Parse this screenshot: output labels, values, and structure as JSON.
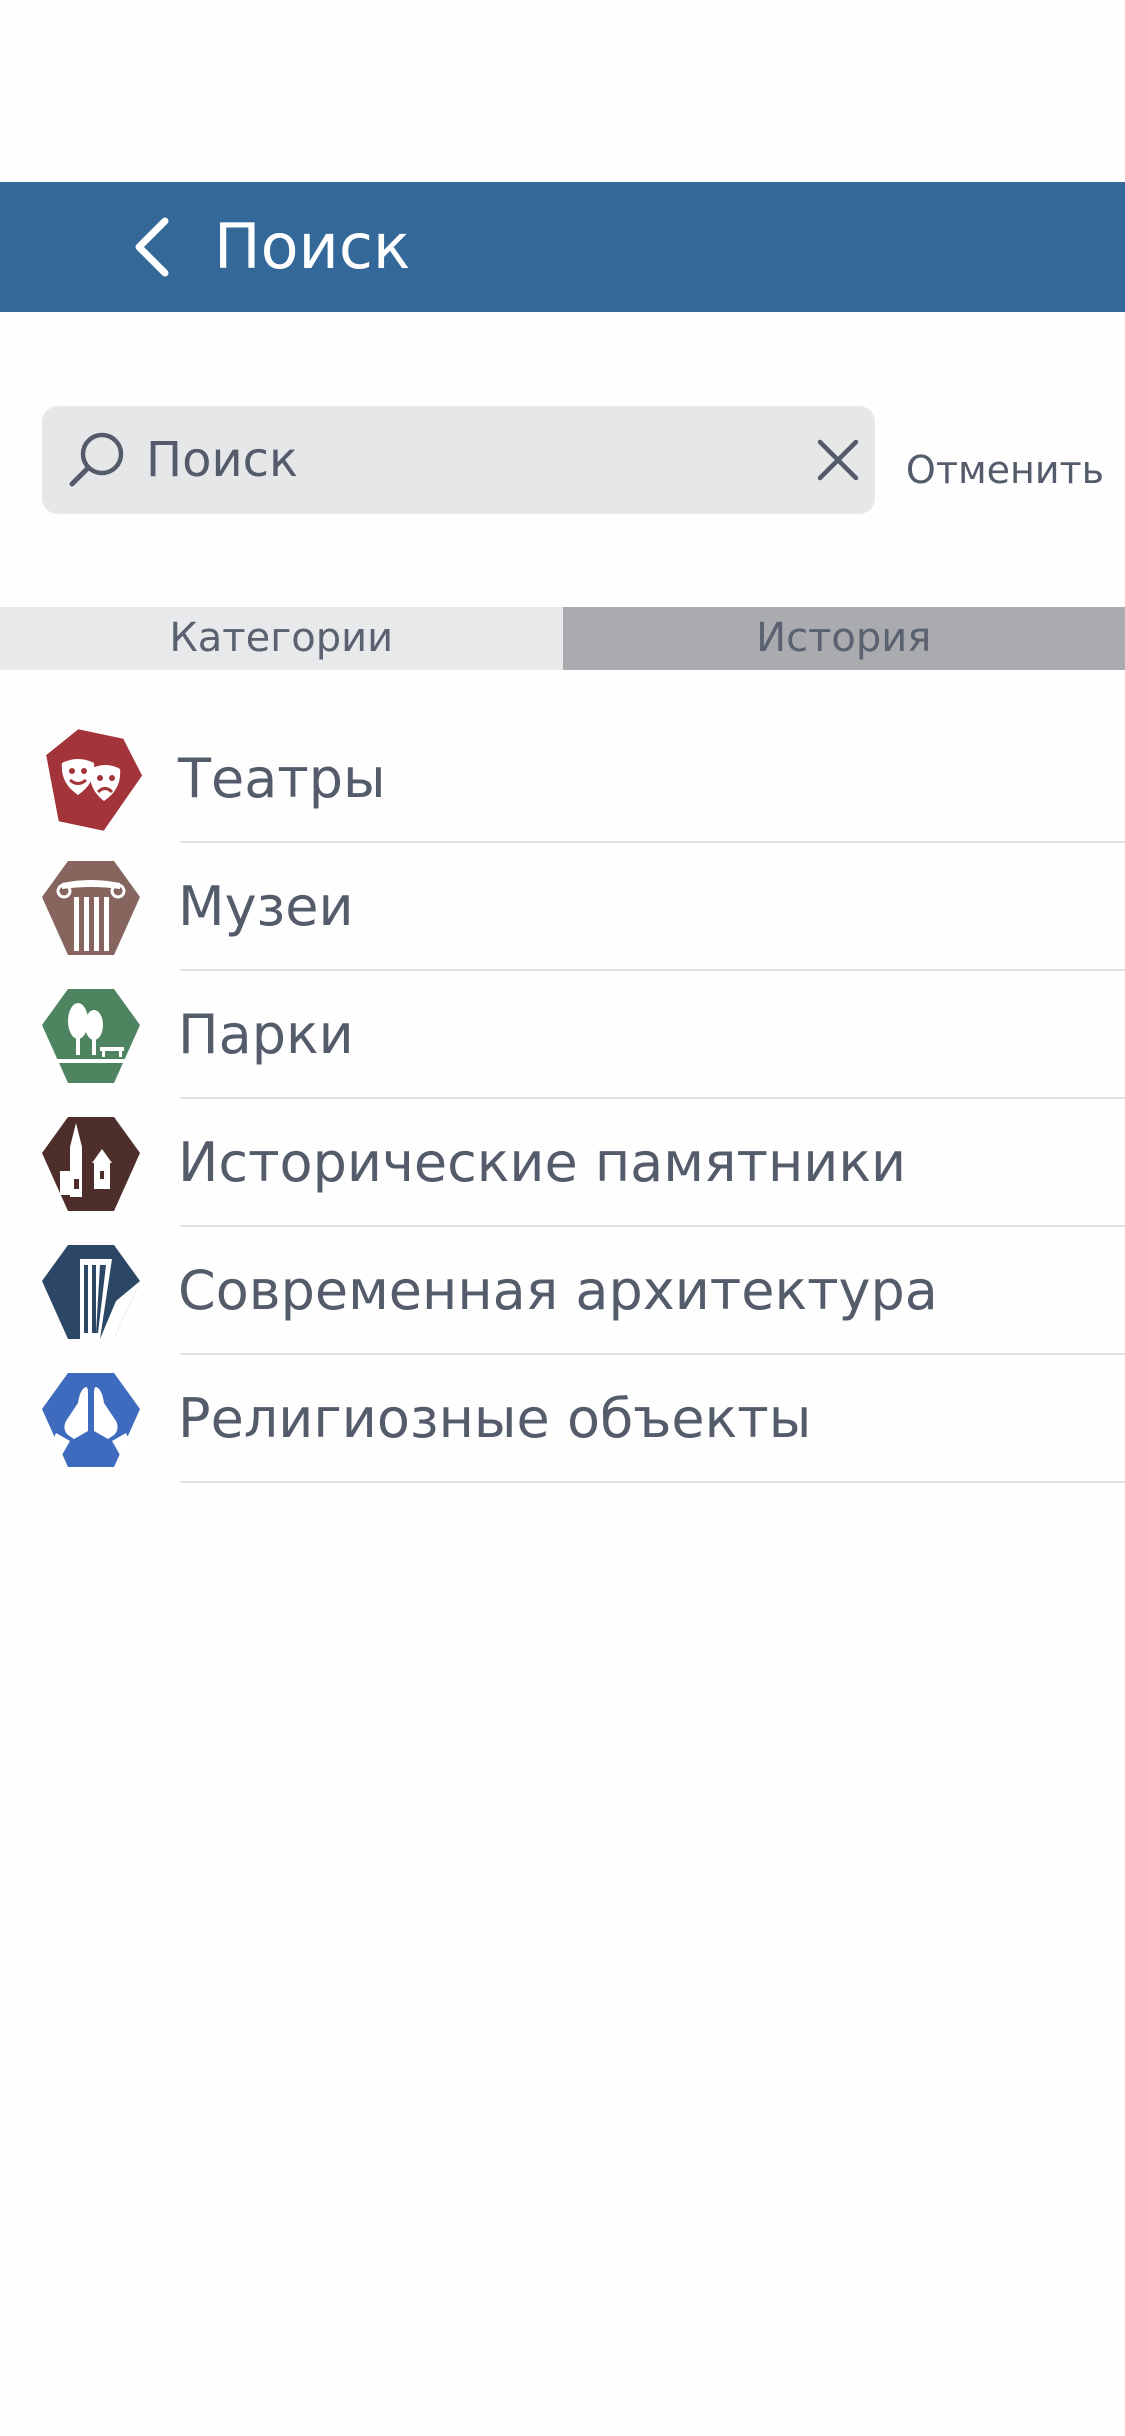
{
  "header": {
    "title": "Поиск",
    "back_icon": "chevron-left-icon"
  },
  "search": {
    "placeholder": "Поиск",
    "value": "",
    "cancel_label": "Отменить"
  },
  "tabs": [
    {
      "label": "Категории",
      "active": true
    },
    {
      "label": "История",
      "active": false
    }
  ],
  "categories": [
    {
      "label": "Театры",
      "icon": "theater-masks-icon",
      "color": "#a3343a"
    },
    {
      "label": "Музеи",
      "icon": "column-icon",
      "color": "#86655e"
    },
    {
      "label": "Парки",
      "icon": "tree-bench-icon",
      "color": "#4e8460"
    },
    {
      "label": "Исторические памятники",
      "icon": "castle-icon",
      "color": "#4e2e2a"
    },
    {
      "label": "Современная архитектура",
      "icon": "skyscraper-icon",
      "color": "#2c4766"
    },
    {
      "label": "Религиозные объекты",
      "icon": "praying-hands-icon",
      "color": "#3f6bbf"
    }
  ],
  "colors": {
    "navbar": "#336899",
    "search_bg": "#e6e7e9",
    "tab_inactive_bg": "#a9abae",
    "tab_active_bg": "#e8e9eb",
    "text": "#545c6c"
  }
}
